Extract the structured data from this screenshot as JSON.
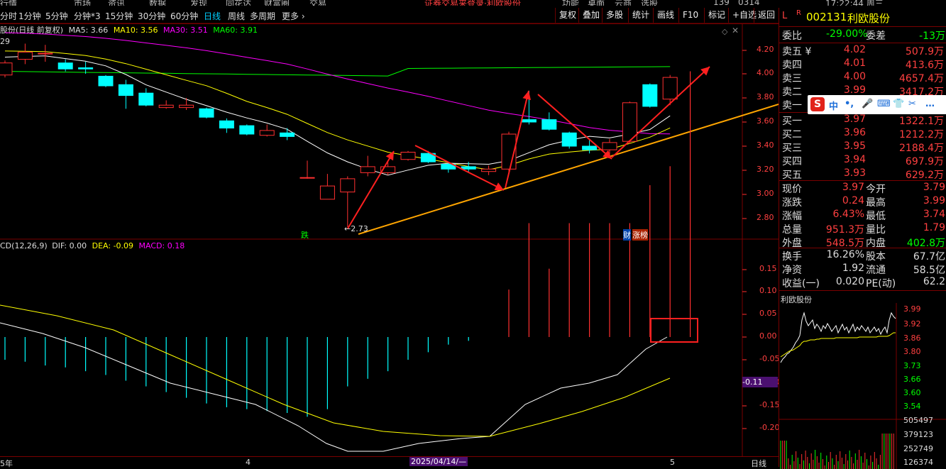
{
  "top_menu": [
    "行情",
    "市场",
    "资讯",
    "数据",
    "发现",
    "同花达",
    "财富圈",
    "交易",
    "证券交易来登录·利欧股份",
    "功能",
    "桌面",
    "云商",
    "选股",
    "139",
    "0314",
    "17:22:44 周三"
  ],
  "period_tabs": [
    "分时",
    "1分钟",
    "5分钟",
    "分钟*3",
    "15分钟",
    "30分钟",
    "60分钟",
    "日线",
    "周线",
    "多周期",
    "更多 ›"
  ],
  "active_period": "日线",
  "toolbar": [
    "复权",
    "叠加",
    "多股",
    "统计",
    "画线",
    "F10",
    "标记",
    "+自选",
    "返回"
  ],
  "indicator": {
    "name": "股份(日线 前复权)",
    "ma5": "MA5: 3.66",
    "ma10": "MA10: 3.56",
    "ma30": "MA30: 3.51",
    "ma60": "MA60: 3.91",
    "topval": "29"
  },
  "price_axis": [
    "4.20",
    "4.00",
    "3.80",
    "3.60",
    "3.40",
    "3.20",
    "3.00",
    "2.80"
  ],
  "low_label": "←2.73",
  "tag_die": "跌",
  "tag_cai": "财",
  "tag_zhangting": "涨榜",
  "macd": {
    "title": "CD(12,26,9)",
    "dif": "DIF: 0.00",
    "dea": "DEA: -0.09",
    "macd": "MACD: 0.18"
  },
  "macd_axis": [
    "0.15",
    "0.10",
    "0.05",
    "0.00",
    "-0.05",
    "-0.10",
    "-0.15",
    "-0.20"
  ],
  "macd_current": "-0.11",
  "date_bar": {
    "left": "5年",
    "mid1": "4",
    "date": "2025/04/14/—",
    "mid2": "5",
    "right": "日线"
  },
  "quote": {
    "flag": "L",
    "code_mark": "R",
    "code": "002131",
    "name": "利欧股份",
    "weibi_label": "委比",
    "weibi": "-29.00%",
    "weicha_label": "委差",
    "weicha": "-13万",
    "asks": [
      {
        "k": "卖五 ¥",
        "p": "4.02",
        "v": "507.9万"
      },
      {
        "k": "卖四",
        "p": "4.01",
        "v": "413.6万"
      },
      {
        "k": "卖三",
        "p": "4.00",
        "v": "4657.4万"
      },
      {
        "k": "卖二",
        "p": "3.99",
        "v": "3417.2万"
      },
      {
        "k": "卖一",
        "p": "",
        "v": ""
      }
    ],
    "bids": [
      {
        "k": "买一",
        "p": "3.97",
        "v": "1322.1万"
      },
      {
        "k": "买二",
        "p": "3.96",
        "v": "1212.2万"
      },
      {
        "k": "买三",
        "p": "3.95",
        "v": "2188.4万"
      },
      {
        "k": "买四",
        "p": "3.94",
        "v": "697.9万"
      },
      {
        "k": "买五",
        "p": "3.93",
        "v": "629.2万"
      }
    ],
    "info": [
      [
        "现价",
        "3.97",
        "今开",
        "3.79"
      ],
      [
        "涨跌",
        "0.24",
        "最高",
        "3.99"
      ],
      [
        "涨幅",
        "6.43%",
        "最低",
        "3.74"
      ],
      [
        "总量",
        "951.3万",
        "量比",
        "1.79"
      ],
      [
        "外盘",
        "548.5万",
        "内盘",
        "402.8万"
      ]
    ],
    "info2": [
      [
        "换手",
        "16.26%",
        "股本",
        "67.7亿"
      ],
      [
        "净资",
        "1.92",
        "流通",
        "58.5亿"
      ],
      [
        "收益(一)",
        "0.020",
        "PE(动)",
        "62.2"
      ]
    ]
  },
  "mini": {
    "title": "利欧股份",
    "prices": [
      "3.99",
      "3.92",
      "3.86",
      "3.80",
      "3.73",
      "3.66",
      "3.60",
      "3.54"
    ],
    "vols": [
      "505497",
      "379123",
      "252749",
      "126374"
    ]
  },
  "sogou": {
    "logo": "S",
    "icons": [
      "中",
      "•,",
      "🎤",
      "⌨",
      "👕",
      "✂",
      "…"
    ]
  },
  "colors": {
    "up": "#ff3030",
    "down": "#00ffff",
    "ma5": "#ffffff",
    "ma10": "#ffff00",
    "ma30": "#ff00ff",
    "ma60": "#00ff00",
    "trend": "#ffa500",
    "grid": "#7a0000"
  },
  "candles": [
    {
      "o": 3.99,
      "c": 4.09,
      "h": 4.11,
      "l": 3.97
    },
    {
      "o": 4.12,
      "c": 4.18,
      "h": 4.25,
      "l": 4.08
    },
    {
      "o": 4.17,
      "c": 4.17,
      "h": 4.24,
      "l": 4.1
    },
    {
      "o": 4.09,
      "c": 4.04,
      "h": 4.12,
      "l": 4.02
    },
    {
      "o": 4.05,
      "c": 4.04,
      "h": 4.1,
      "l": 4.0
    },
    {
      "o": 3.98,
      "c": 3.9,
      "h": 3.99,
      "l": 3.89
    },
    {
      "o": 3.91,
      "c": 3.82,
      "h": 3.95,
      "l": 3.71
    },
    {
      "o": 3.84,
      "c": 3.74,
      "h": 3.88,
      "l": 3.73
    },
    {
      "o": 3.72,
      "c": 3.74,
      "h": 3.78,
      "l": 3.71
    },
    {
      "o": 3.72,
      "c": 3.74,
      "h": 3.8,
      "l": 3.7
    },
    {
      "o": 3.71,
      "c": 3.64,
      "h": 3.72,
      "l": 3.63
    },
    {
      "o": 3.61,
      "c": 3.55,
      "h": 3.63,
      "l": 3.51
    },
    {
      "o": 3.57,
      "c": 3.5,
      "h": 3.58,
      "l": 3.49
    },
    {
      "o": 3.49,
      "c": 3.53,
      "h": 3.58,
      "l": 3.48
    },
    {
      "o": 3.51,
      "c": 3.48,
      "h": 3.55,
      "l": 3.45
    },
    {
      "o": 3.14,
      "c": 3.14,
      "h": 3.28,
      "l": 3.13
    },
    {
      "o": 2.96,
      "c": 3.07,
      "h": 3.17,
      "l": 2.96
    },
    {
      "o": 3.02,
      "c": 3.13,
      "h": 3.15,
      "l": 2.73
    },
    {
      "o": 3.18,
      "c": 3.23,
      "h": 3.32,
      "l": 3.15
    },
    {
      "o": 3.18,
      "c": 3.23,
      "h": 3.28,
      "l": 3.16
    },
    {
      "o": 3.29,
      "c": 3.35,
      "h": 3.36,
      "l": 3.28
    },
    {
      "o": 3.34,
      "c": 3.27,
      "h": 3.36,
      "l": 3.26
    },
    {
      "o": 3.25,
      "c": 3.21,
      "h": 3.27,
      "l": 3.18
    },
    {
      "o": 3.23,
      "c": 3.21,
      "h": 3.27,
      "l": 3.18
    },
    {
      "o": 3.19,
      "c": 3.21,
      "h": 3.24,
      "l": 3.16
    },
    {
      "o": 3.21,
      "c": 3.5,
      "h": 3.52,
      "l": 3.18
    },
    {
      "o": 3.62,
      "c": 3.6,
      "h": 3.86,
      "l": 3.58
    },
    {
      "o": 3.62,
      "c": 3.54,
      "h": 3.68,
      "l": 3.53
    },
    {
      "o": 3.51,
      "c": 3.4,
      "h": 3.52,
      "l": 3.38
    },
    {
      "o": 3.4,
      "c": 3.37,
      "h": 3.45,
      "l": 3.34
    },
    {
      "o": 3.37,
      "c": 3.43,
      "h": 3.46,
      "l": 3.33
    },
    {
      "o": 3.44,
      "c": 3.76,
      "h": 3.77,
      "l": 3.42
    },
    {
      "o": 3.91,
      "c": 3.73,
      "h": 3.92,
      "l": 3.72
    },
    {
      "o": 3.79,
      "c": 3.97,
      "h": 3.99,
      "l": 3.74
    }
  ],
  "macd_bars": [
    -0.012,
    -0.013,
    -0.015,
    -0.016,
    -0.018,
    -0.02,
    -0.023,
    -0.026,
    -0.029,
    -0.032,
    -0.035,
    -0.037,
    -0.038,
    -0.039,
    -0.04,
    -0.042,
    -0.038,
    -0.026,
    -0.022,
    -0.018,
    -0.012,
    -0.008,
    -0.004,
    -0.002,
    0.0,
    0.025,
    0.06,
    0.036,
    0.06,
    0.06,
    0.06,
    0.06,
    0.08,
    0.09,
    0.14
  ]
}
